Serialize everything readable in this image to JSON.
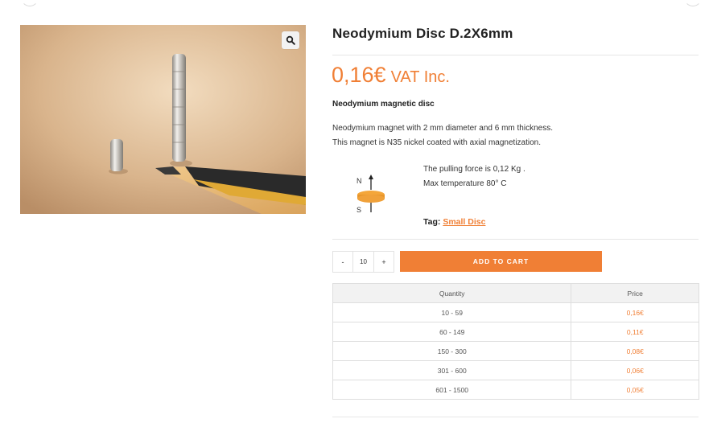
{
  "product": {
    "title": "Neodymium Disc D.2X6mm",
    "price": "0,16€",
    "vat": "VAT Inc.",
    "subtitle": "Neodymium magnetic disc",
    "description": [
      "Neodymium magnet with 2 mm diameter and 6 mm thickness.",
      "This magnet is N35 nickel coated with axial magnetization."
    ],
    "specs": [
      "The pulling force is 0,12 Kg .",
      "Max temperature 80° C"
    ],
    "magnet_icon": {
      "north": "N",
      "south": "S"
    },
    "tag_label": "Tag:",
    "tag_link": "Small Disc",
    "zoom_icon": "magnifier-icon"
  },
  "cart": {
    "minus": "-",
    "quantity": "10",
    "plus": "+",
    "button": "ADD TO CART"
  },
  "pricing": {
    "headers": [
      "Quantity",
      "Price"
    ],
    "rows": [
      {
        "quantity": "10 - 59",
        "price": "0,16€"
      },
      {
        "quantity": "60 - 149",
        "price": "0,11€"
      },
      {
        "quantity": "150 - 300",
        "price": "0,08€"
      },
      {
        "quantity": "301 - 600",
        "price": "0,06€"
      },
      {
        "quantity": "601 - 1500",
        "price": "0,05€"
      }
    ]
  },
  "colors": {
    "accent": "#f07f35",
    "magnet": "#f4a63a"
  }
}
